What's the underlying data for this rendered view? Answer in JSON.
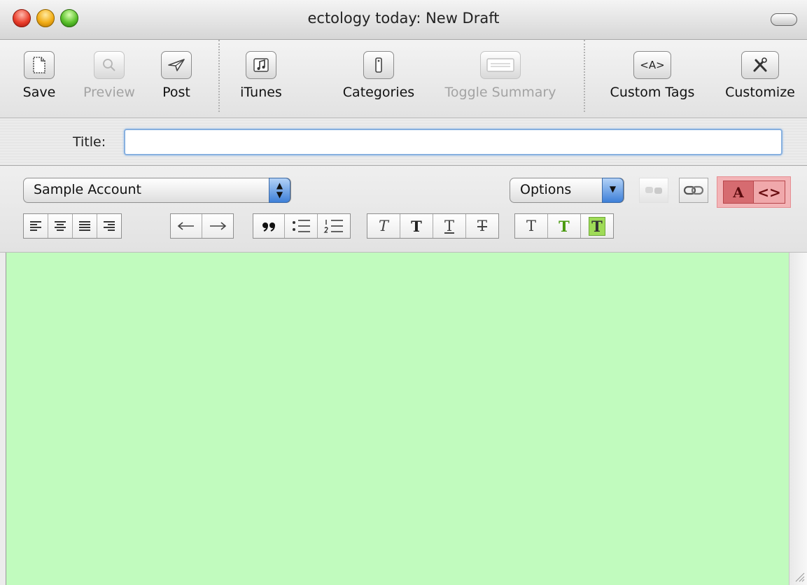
{
  "window": {
    "title": "ectology today: New Draft"
  },
  "toolbar": {
    "save": "Save",
    "preview": "Preview",
    "post": "Post",
    "itunes": "iTunes",
    "categories": "Categories",
    "toggle_summary": "Toggle Summary",
    "custom_tags": "Custom Tags",
    "custom_tags_glyph": "<A>",
    "customize": "Customize"
  },
  "title_field": {
    "label": "Title:",
    "value": ""
  },
  "format_bar": {
    "account": "Sample Account",
    "options": "Options",
    "mode_rich": "A",
    "mode_code": "<>"
  },
  "text_styles": [
    "T",
    "T",
    "T",
    "T"
  ],
  "text_colors": [
    "T",
    "T",
    "T"
  ],
  "colors": {
    "editor_background": "#c1fbbe",
    "mode_highlight": "#f3b4b7",
    "color_green": "#4a9a10",
    "highlight_green": "#9fdb57"
  },
  "editor": {
    "content": ""
  }
}
